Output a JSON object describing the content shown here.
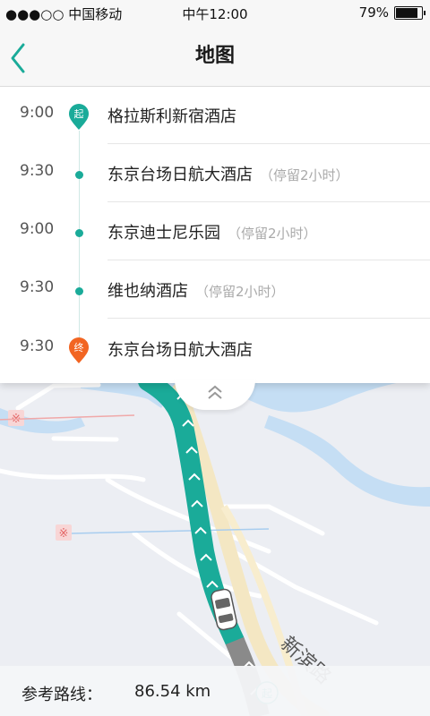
{
  "status_bar": {
    "carrier": "●●●○○ 中国移动",
    "time": "中午12:00",
    "battery_text": "79%",
    "battery_level": 0.79
  },
  "nav": {
    "title": "地图"
  },
  "itinerary": [
    {
      "time": "9:00",
      "name": "格拉斯利新宿酒店",
      "note": "",
      "marker": "start",
      "marker_label": "起"
    },
    {
      "time": "9:30",
      "name": "东京台场日航大酒店",
      "note": "（停留2小时）",
      "marker": "dot"
    },
    {
      "time": "9:00",
      "name": "东京迪士尼乐园",
      "note": "（停留2小时）",
      "marker": "dot"
    },
    {
      "time": "9:30",
      "name": "维也纳酒店",
      "note": "（停留2小时）",
      "marker": "dot"
    },
    {
      "time": "9:30",
      "name": "东京台场日航大酒店",
      "note": "",
      "marker": "end",
      "marker_label": "终"
    }
  ],
  "map": {
    "road_label": "新滨路",
    "start_marker_label": "起"
  },
  "summary": {
    "label": "参考路线：",
    "value": "86.54 km"
  },
  "colors": {
    "accent": "#1aab99",
    "end_marker": "#f26522",
    "water": "#c5def4",
    "route": "#1aab99",
    "road_major": "#f4e7c3"
  }
}
